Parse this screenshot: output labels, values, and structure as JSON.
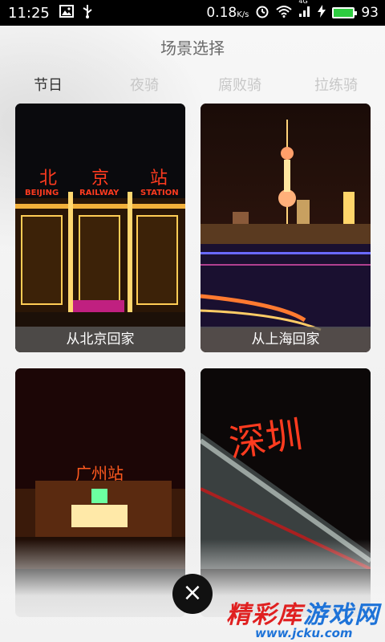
{
  "status_bar": {
    "time": "11:25",
    "network_speed": "0.18",
    "speed_unit": "K/s",
    "network_type": "4G",
    "battery_percent": "93",
    "icons": [
      "image-icon",
      "usb-icon",
      "alarm-icon",
      "wifi-icon",
      "signal-icon",
      "charging-icon",
      "battery-icon"
    ]
  },
  "header": {
    "title": "场景选择"
  },
  "tabs": [
    {
      "label": "节日",
      "active": true
    },
    {
      "label": "夜骑",
      "active": false
    },
    {
      "label": "腐败骑",
      "active": false
    },
    {
      "label": "拉练骑",
      "active": false
    }
  ],
  "scenes": [
    {
      "label": "从北京回家",
      "sign_cn": "北京站",
      "sign_en_1": "BEIJING",
      "sign_en_2": "RAILWAY",
      "sign_en_3": "STATION"
    },
    {
      "label": "从上海回家"
    },
    {
      "label": "",
      "sign_cn": "广州站"
    },
    {
      "label": "",
      "sign_cn": "深圳"
    }
  ],
  "close": {
    "symbol": "×"
  },
  "watermark": {
    "part1": "精彩库",
    "part2": "游戏网",
    "url": "www.jcku.com"
  },
  "colors": {
    "accent_neon": "#ff3b1f",
    "active_tab": "#333333",
    "inactive_tab": "#c7c7c7"
  }
}
